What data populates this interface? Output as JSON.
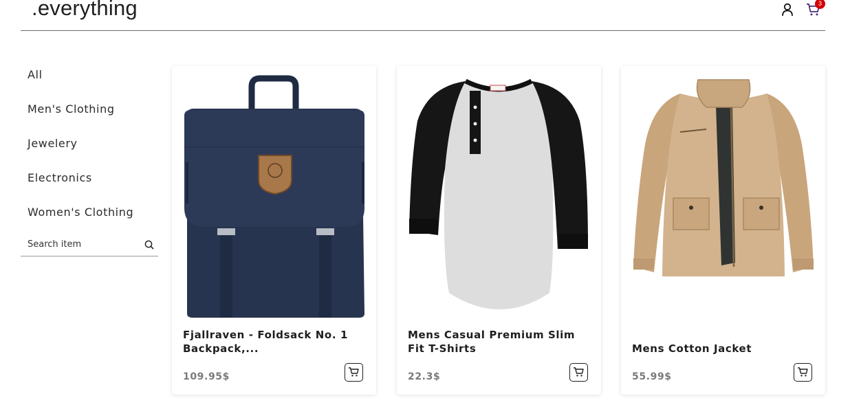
{
  "header": {
    "logo": ".everything",
    "cart_count": "3"
  },
  "sidebar": {
    "categories": [
      {
        "label": "All"
      },
      {
        "label": "Men's Clothing"
      },
      {
        "label": "Jewelery"
      },
      {
        "label": "Electronics"
      },
      {
        "label": "Women's Clothing"
      }
    ],
    "search": {
      "placeholder": "Search item",
      "value": ""
    }
  },
  "products": [
    {
      "title": "Fjallraven - Foldsack No. 1 Backpack,...",
      "price": "109.95$",
      "image": "navy-backpack"
    },
    {
      "title": "Mens Casual Premium Slim Fit T-Shirts",
      "price": "22.3$",
      "image": "raglan-henley-tshirt"
    },
    {
      "title": "Mens Cotton Jacket",
      "price": "55.99$",
      "image": "khaki-cotton-jacket"
    }
  ],
  "colors": {
    "badge": "#d40000",
    "backpack": "#27344f",
    "jacket": "#cfb08a"
  },
  "icons": {
    "user": "user-icon",
    "cart": "cart-icon",
    "search": "search-icon",
    "add_to_cart": "add-to-cart-icon"
  }
}
